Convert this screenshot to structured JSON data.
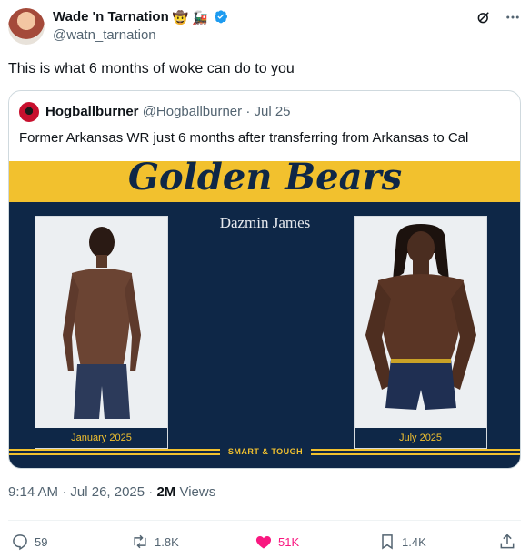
{
  "author": {
    "display_name": "Wade 'n Tarnation",
    "handle": "@watn_tarnation",
    "emojis": [
      "🤠",
      "🚂"
    ],
    "verified_color": "#1d9bf0"
  },
  "tweet": {
    "text": "This is what 6 months of woke can do to you"
  },
  "quote": {
    "author_name": "Hogballburner",
    "author_handle": "@Hogballburner",
    "separator": "·",
    "date": "Jul 25",
    "text": "Former Arkansas WR just 6 months after transferring from Arkansas to Cal",
    "image": {
      "banner_title": "Golden Bears",
      "subject_name": "Dazmin James",
      "left_label": "January 2025",
      "right_label": "July 2025",
      "motto": "SMART & TOUGH",
      "colors": {
        "navy": "#0e2747",
        "gold": "#f2c12e"
      }
    }
  },
  "meta": {
    "time": "9:14 AM",
    "separator": "·",
    "date": "Jul 26, 2025",
    "views_count": "2M",
    "views_label": "Views"
  },
  "actions": {
    "replies": "59",
    "reposts": "1.8K",
    "likes": "51K",
    "bookmarks": "1.4K",
    "like_color": "#f91880"
  },
  "icons": [
    "grok-icon",
    "more-icon",
    "reply-icon",
    "repost-icon",
    "heart-icon",
    "bookmark-icon",
    "share-icon",
    "verified-icon"
  ]
}
